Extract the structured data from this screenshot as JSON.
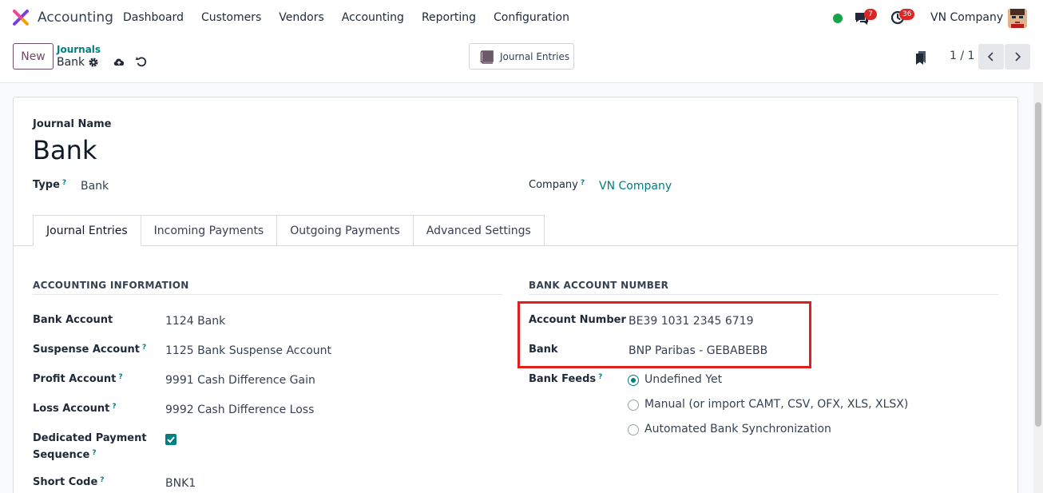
{
  "navbar": {
    "app_name": "Accounting",
    "menu": [
      "Dashboard",
      "Customers",
      "Vendors",
      "Accounting",
      "Reporting",
      "Configuration"
    ],
    "messages_count": "7",
    "activities_count": "36",
    "company": "VN Company"
  },
  "control": {
    "new_label": "New",
    "breadcrumb_parent": "Journals",
    "breadcrumb_current": "Bank",
    "smart_button": "Journal Entries",
    "pager": "1 / 1"
  },
  "form": {
    "journal_name_label": "Journal Name",
    "journal_name": "Bank",
    "type_label": "Type",
    "type_value": "Bank",
    "company_label": "Company",
    "company_value": "VN Company",
    "help_mark": "?"
  },
  "tabs": [
    "Journal Entries",
    "Incoming Payments",
    "Outgoing Payments",
    "Advanced Settings"
  ],
  "accounting_info": {
    "title": "ACCOUNTING INFORMATION",
    "bank_account_label": "Bank Account",
    "bank_account": "1124 Bank",
    "suspense_label": "Suspense Account",
    "suspense": "1125 Bank Suspense Account",
    "profit_label": "Profit Account",
    "profit": "9991 Cash Difference Gain",
    "loss_label": "Loss Account",
    "loss": "9992 Cash Difference Loss",
    "dedicated_label_1": "Dedicated Payment",
    "dedicated_label_2": "Sequence",
    "dedicated_checked": true,
    "short_code_label": "Short Code",
    "short_code": "BNK1"
  },
  "bank_account_number": {
    "title": "BANK ACCOUNT NUMBER",
    "account_number_label": "Account Number",
    "account_number": "BE39 1031 2345 6719",
    "bank_label": "Bank",
    "bank": "BNP Paribas - GEBABEBB",
    "bank_feeds_label": "Bank Feeds",
    "feeds_options": [
      "Undefined Yet",
      "Manual (or import CAMT, CSV, OFX, XLS, XLSX)",
      "Automated Bank Synchronization"
    ],
    "feeds_selected": "Undefined Yet"
  },
  "colors": {
    "brand": "#714b67",
    "accent": "#017e84",
    "highlight": "#e11d1d"
  }
}
